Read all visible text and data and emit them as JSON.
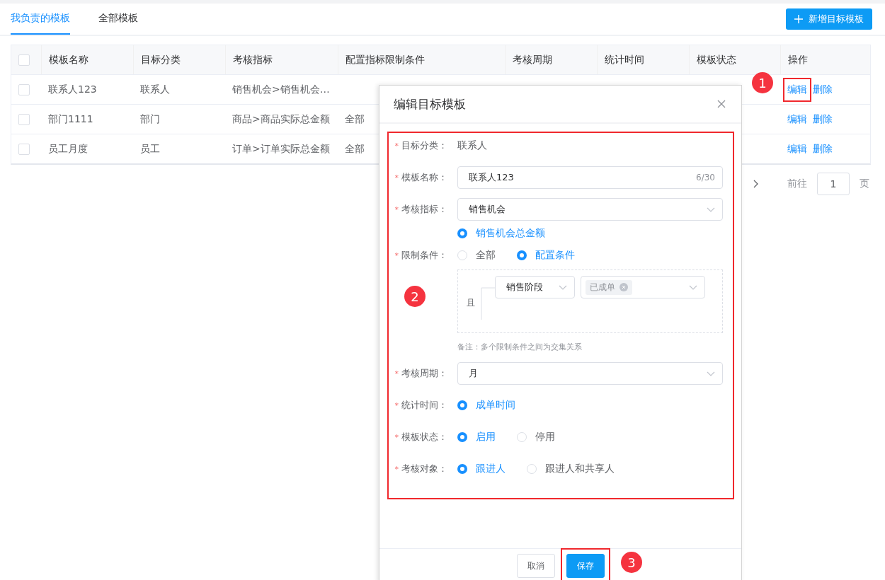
{
  "tabs": [
    {
      "label": "我负责的模板",
      "selected": true
    },
    {
      "label": "全部模板",
      "selected": false
    }
  ],
  "add_button": {
    "label": "新增目标模板"
  },
  "table": {
    "select_all": {
      "checked": false
    },
    "columns": [
      "模板名称",
      "目标分类",
      "考核指标",
      "配置指标限制条件",
      "考核周期",
      "统计时间",
      "模板状态",
      "操作"
    ],
    "rows": [
      {
        "checked": false,
        "name": "联系人123",
        "category": "联系人",
        "metric": "销售机会>销售机会…",
        "actions": [
          {
            "label": "编辑",
            "highlighted": true
          },
          {
            "label": "删除",
            "highlighted": false
          }
        ]
      },
      {
        "checked": false,
        "name": "部门1111",
        "category": "部门",
        "metric": "商品>商品实际总金额",
        "condition": "全部",
        "actions": [
          {
            "label": "编辑",
            "highlighted": false
          },
          {
            "label": "删除",
            "highlighted": false
          }
        ]
      },
      {
        "checked": false,
        "name": "员工月度",
        "category": "员工",
        "metric": "订单>订单实际总金额",
        "condition": "全部",
        "actions": [
          {
            "label": "编辑",
            "highlighted": false
          },
          {
            "label": "删除",
            "highlighted": false
          }
        ]
      }
    ]
  },
  "pagination": {
    "goto_label": "前往",
    "page": "1",
    "page_suffix": "页"
  },
  "callouts": [
    "1",
    "2",
    "3"
  ],
  "dialog": {
    "title": "编辑目标模板",
    "form_highlighted": true,
    "fields": [
      {
        "kind": "text",
        "label": "目标分类：",
        "required_mark": "*",
        "value": "联系人"
      },
      {
        "kind": "input",
        "label": "模板名称：",
        "required_mark": "*",
        "value": "联系人123",
        "counter": "6/30"
      },
      {
        "kind": "select",
        "label": "考核指标：",
        "required_mark": "*",
        "value": "销售机会"
      },
      {
        "kind": "radio",
        "options": [
          {
            "label": "销售机会总金额",
            "selected": true
          }
        ]
      },
      {
        "kind": "radio",
        "label": "限制条件：",
        "required_mark": "*",
        "options": [
          {
            "label": "全部",
            "selected": false
          },
          {
            "label": "配置条件",
            "selected": true
          }
        ]
      },
      {
        "kind": "conditions",
        "connector": "且",
        "conditions": [
          {
            "field": "销售阶段",
            "tags": [
              "已成单"
            ]
          }
        ]
      },
      {
        "kind": "note",
        "value": "备注：多个限制条件之间为交集关系"
      },
      {
        "kind": "select",
        "label": "考核周期：",
        "required_mark": "*",
        "value": "月"
      },
      {
        "kind": "radio",
        "label": "统计时间：",
        "required_mark": "*",
        "options": [
          {
            "label": "成单时间",
            "selected": true
          }
        ]
      },
      {
        "kind": "radio",
        "label": "模板状态：",
        "required_mark": "*",
        "options": [
          {
            "label": "启用",
            "selected": true
          },
          {
            "label": "停用",
            "selected": false
          }
        ]
      },
      {
        "kind": "radio",
        "label": "考核对象：",
        "required_mark": "*",
        "options": [
          {
            "label": "跟进人",
            "selected": true
          },
          {
            "label": "跟进人和共享人",
            "selected": false
          }
        ]
      }
    ],
    "buttons": [
      {
        "label": "取消",
        "kind": "secondary",
        "highlighted": false
      },
      {
        "label": "保存",
        "kind": "primary",
        "highlighted": true
      }
    ]
  }
}
